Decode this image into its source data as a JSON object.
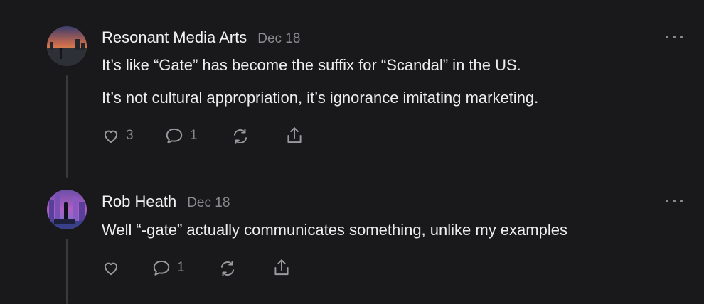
{
  "comments": [
    {
      "author": "Resonant Media Arts",
      "date": "Dec 18",
      "paragraphs": [
        "It’s like “Gate” has become the suffix for “Scandal” in the US.",
        "It’s not cultural appropriation, it’s ignorance imitating marketing."
      ],
      "likes": "3",
      "replies": "1",
      "icons": [
        "heart-icon",
        "comment-icon",
        "restack-icon",
        "share-icon",
        "more-icon"
      ]
    },
    {
      "author": "Rob Heath",
      "date": "Dec 18",
      "paragraphs": [
        "Well “-gate” actually communicates something, unlike my examples"
      ],
      "likes": "",
      "replies": "1",
      "icons": [
        "heart-icon",
        "comment-icon",
        "restack-icon",
        "share-icon",
        "more-icon"
      ]
    }
  ],
  "colors": {
    "background": "#19191b",
    "text": "#ededed",
    "muted": "#8a8a8e",
    "thread_line": "#3a3a3c"
  }
}
